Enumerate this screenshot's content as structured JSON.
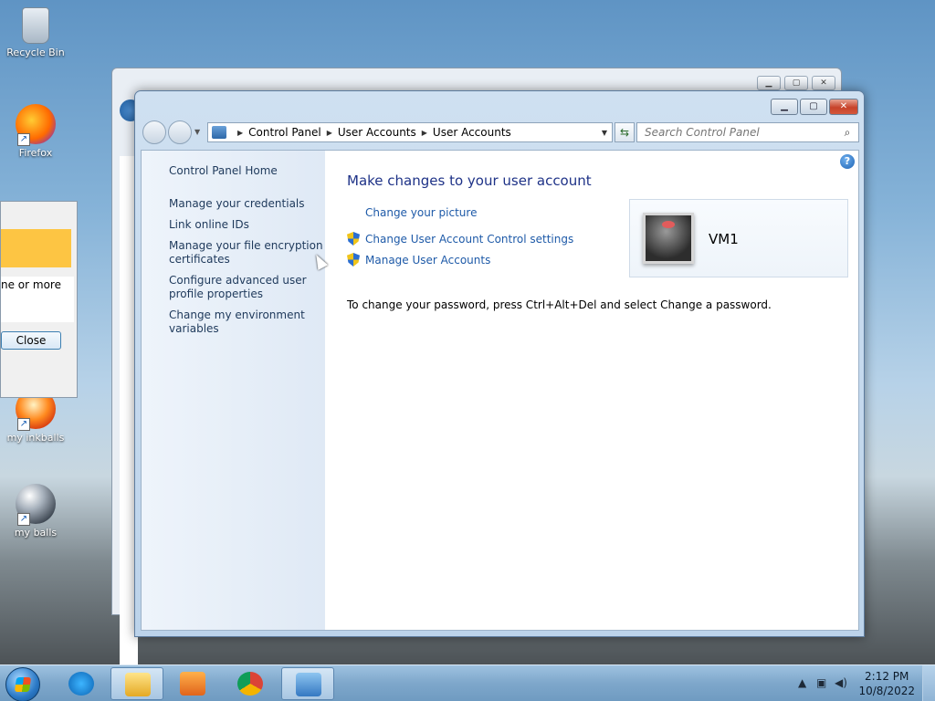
{
  "desktop": {
    "icons": [
      {
        "label": "Recycle Bin"
      },
      {
        "label": "Firefox"
      },
      {
        "label": "my inkballs"
      },
      {
        "label": "my balls"
      }
    ]
  },
  "dialog": {
    "message": "ne or more",
    "close_label": "Close"
  },
  "window": {
    "address": {
      "crumbs": [
        "Control Panel",
        "User Accounts",
        "User Accounts"
      ]
    },
    "search": {
      "placeholder": "Search Control Panel"
    },
    "sidebar": {
      "items": [
        "Control Panel Home",
        "Manage your credentials",
        "Link online IDs",
        "Manage your file encryption certificates",
        "Configure advanced user profile properties",
        "Change my environment variables"
      ]
    },
    "main": {
      "title": "Make changes to your user account",
      "links": [
        "Change your picture",
        "Change User Account Control settings",
        "Manage User Accounts"
      ],
      "user_name": "VM1",
      "password_note": "To change your password, press Ctrl+Alt+Del and select Change a password.",
      "help": "?"
    }
  },
  "taskbar": {
    "clock_time": "2:12 PM",
    "clock_date": "10/8/2022"
  },
  "colors": {
    "link": "#1e5aa8",
    "title": "#1e3287",
    "sidebar_text": "#1e395b"
  }
}
